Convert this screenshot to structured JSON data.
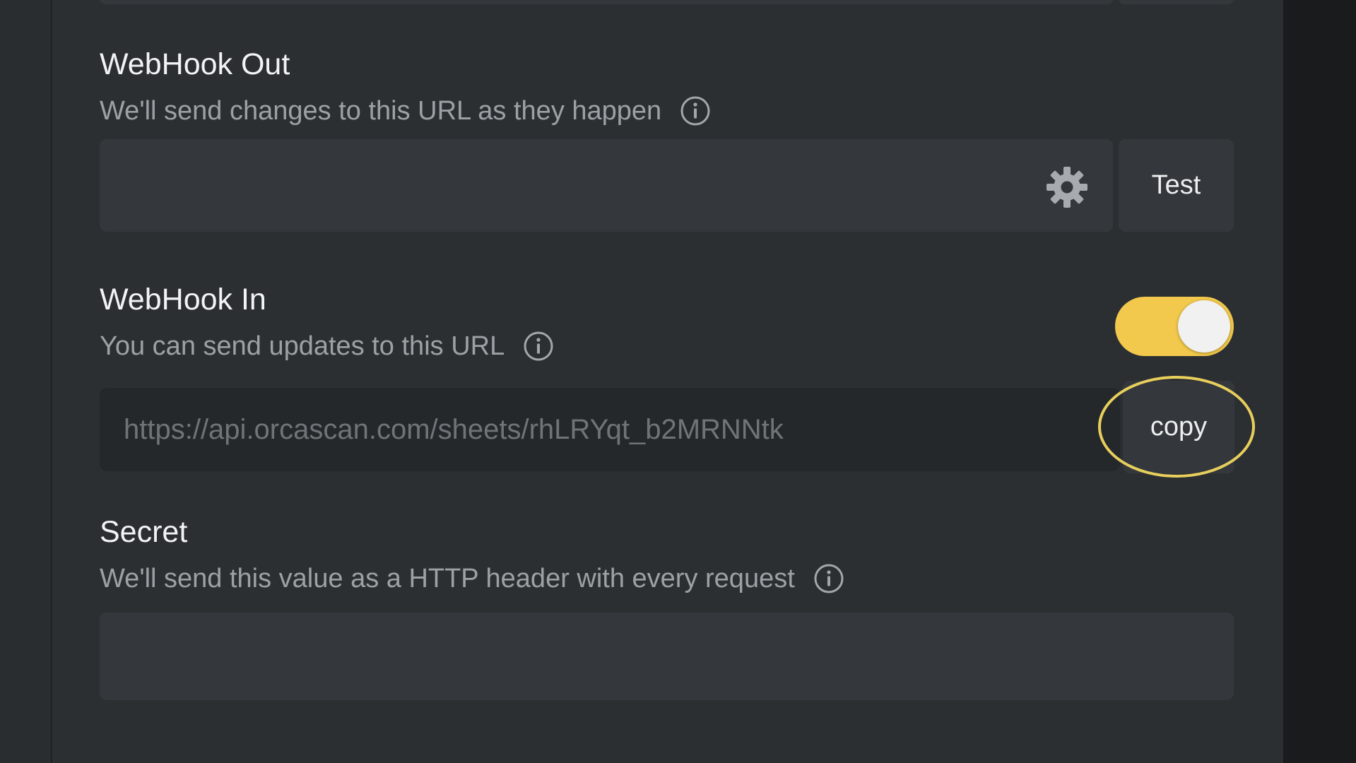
{
  "webhook_out": {
    "title": "WebHook Out",
    "description": "We'll send changes to this URL as they happen",
    "url_value": "",
    "settings_icon": "gear-icon",
    "test_label": "Test"
  },
  "webhook_in": {
    "title": "WebHook In",
    "description": "You can send updates to this URL",
    "enabled": true,
    "url_value": "https://api.orcascan.com/sheets/rhLRYqt_b2MRNNtk",
    "copy_label": "copy"
  },
  "secret": {
    "title": "Secret",
    "description": "We'll send this value as a HTTP header with every request",
    "value": ""
  },
  "colors": {
    "panel_bg": "#2c2f32",
    "input_bg": "#34383c",
    "toggle_on": "#f2c94c",
    "highlight": "#e8cf5c"
  },
  "icons": {
    "info": "info-icon",
    "settings": "gear-icon"
  }
}
